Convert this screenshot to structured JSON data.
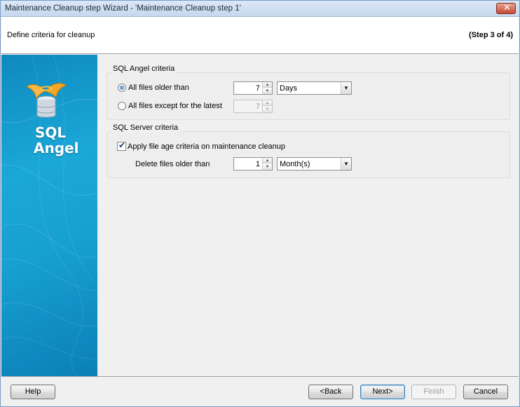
{
  "window": {
    "title": "Maintenance Cleanup step Wizard - 'Maintenance Cleanup step 1'",
    "close_glyph": "✕"
  },
  "header": {
    "subtitle": "Define criteria for cleanup",
    "step": "(Step 3 of 4)"
  },
  "sidebar": {
    "logo_line1": "SQL",
    "logo_line2": "Angel",
    "logo_icon": "sql-angel-logo-icon"
  },
  "sql_angel_criteria": {
    "group_title": "SQL Angel criteria",
    "option_older_label": "All files older than",
    "option_older_checked": true,
    "older_value": "7",
    "older_unit": "Days",
    "option_except_label": "All files except for the latest",
    "option_except_checked": false,
    "except_value": "7"
  },
  "sql_server_criteria": {
    "group_title": "SQL Server criteria",
    "apply_label": "Apply file age criteria on maintenance cleanup",
    "apply_checked": true,
    "delete_label": "Delete files older than",
    "delete_value": "1",
    "delete_unit": "Month(s)"
  },
  "footer": {
    "help": "Help",
    "back": "<Back",
    "next": "Next>",
    "finish": "Finish",
    "cancel": "Cancel"
  },
  "colors": {
    "sidebar_blue": "#17a0d2",
    "accent_border": "#3c7fb1"
  }
}
